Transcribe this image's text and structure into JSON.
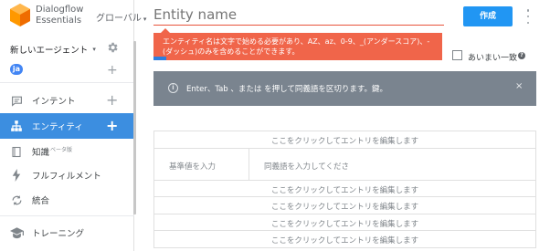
{
  "brand": {
    "name_line1": "Dialogflow",
    "name_line2": "Essentials",
    "scope_label": "グローバル",
    "scope_caret": "▾"
  },
  "agent": {
    "name": "新しいエージェント",
    "caret": "▾",
    "language": "ja",
    "add_symbol": "+"
  },
  "nav": [
    {
      "id": "intents",
      "label": "インテント",
      "icon": "chat-bubble-icon",
      "add": "+"
    },
    {
      "id": "entities",
      "label": "エンティティ",
      "icon": "entity-hierarchy-icon",
      "add": "+",
      "active": true
    },
    {
      "id": "knowledge",
      "label": "知識",
      "sup": "ベータ版",
      "icon": "book-icon"
    },
    {
      "id": "fulfillment",
      "label": "フルフィルメント",
      "icon": "bolt-icon"
    },
    {
      "id": "integrations",
      "label": "統合",
      "icon": "sync-icon"
    },
    {
      "id": "training",
      "label": "トレーニング",
      "icon": "graduation-cap-icon"
    }
  ],
  "header": {
    "entity_placeholder": "Entity name",
    "save_label": "作成"
  },
  "error_tip": {
    "line1": "エンティティ名は文字で始める必要があり、AZ、az、0-9、_(アンダースコア)、-",
    "line2": "(ダッシュ)のみを含めることができます。"
  },
  "options": {
    "fuzzy_label": "あいまい一致",
    "help": "?"
  },
  "info": {
    "icon": "i",
    "text": "Enter、Tab 、または を押して同義語を区切ります。鍵。",
    "close": "×"
  },
  "table": {
    "click_edit": "ここをクリックしてエントリを編集します",
    "reference_placeholder": "基準値を入力",
    "synonym_placeholder": "同義語を入力してくださ"
  },
  "colors": {
    "accent": "#2196f3",
    "active_nav": "#3c8ee0",
    "error": "#f0654a",
    "info_bg": "#7a848f"
  }
}
